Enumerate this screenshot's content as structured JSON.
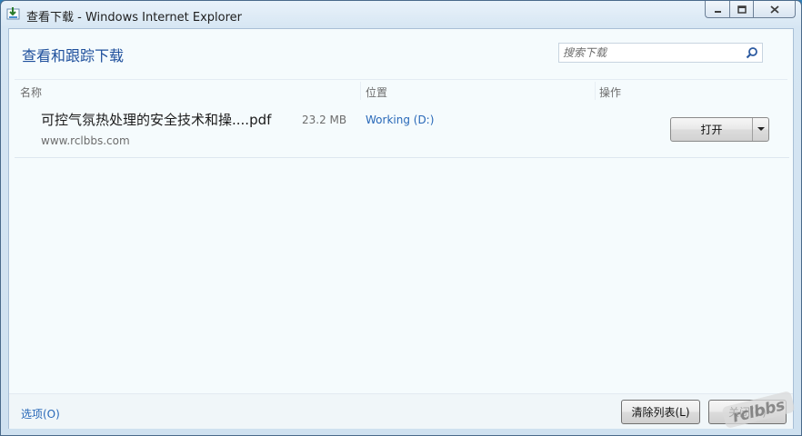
{
  "window": {
    "title": "查看下载 - Windows Internet Explorer",
    "icon": "ie-downloads-icon"
  },
  "header": {
    "title": "查看和跟踪下载"
  },
  "search": {
    "placeholder": "搜索下载",
    "value": ""
  },
  "columns": {
    "name": "名称",
    "location": "位置",
    "actions": "操作"
  },
  "downloads": [
    {
      "name": "可控气氛热处理的安全技术和操....pdf",
      "size": "23.2 MB",
      "source": "www.rclbbs.com",
      "location": "Working (D:)",
      "action": "打开"
    }
  ],
  "footer": {
    "options": "选项(O)",
    "clear": "清除列表(L)",
    "close": "关闭(C)"
  },
  "watermark": {
    "text": "rclbbs"
  }
}
